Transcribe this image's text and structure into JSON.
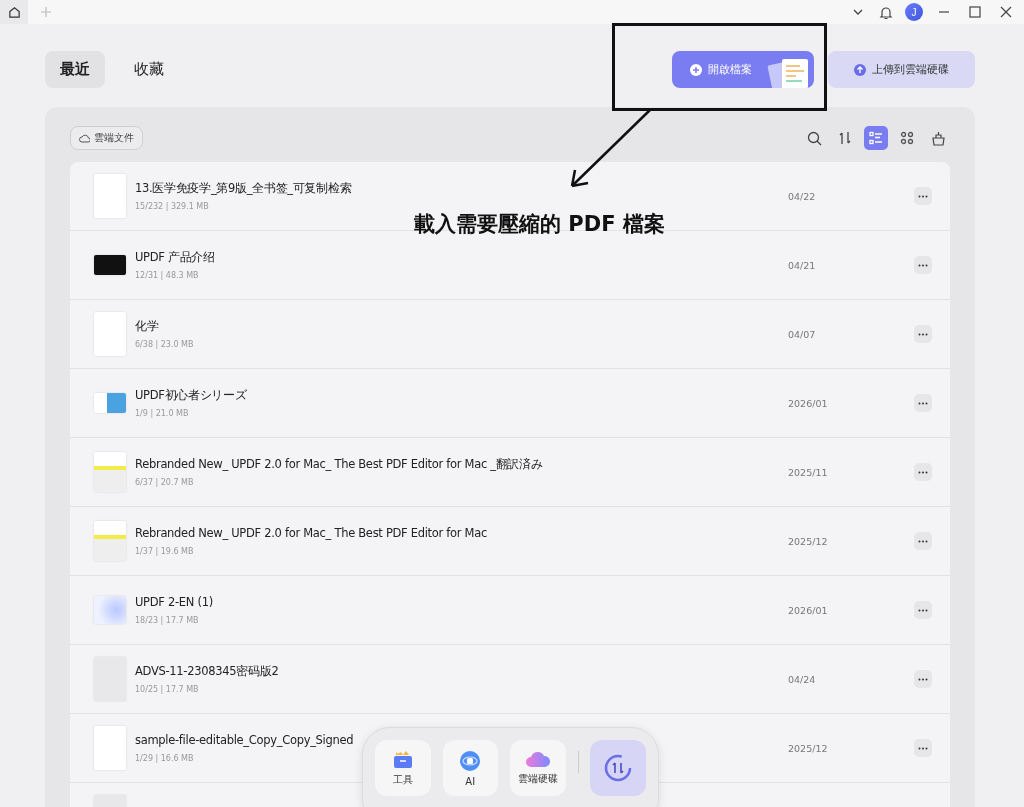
{
  "title_bar": {
    "avatar": "J"
  },
  "tabs": [
    {
      "label": "最近",
      "selected": true
    },
    {
      "label": "收藏",
      "selected": false
    }
  ],
  "actions": [
    {
      "kind": "open",
      "label": "開啟檔案"
    },
    {
      "kind": "upload",
      "label": "上傳到雲端硬碟"
    }
  ],
  "cloud_chip": "雲端文件",
  "view_modes": [
    {
      "kind": "list",
      "selected": true
    },
    {
      "kind": "grid",
      "selected": false
    }
  ],
  "files": [
    {
      "name": "13.医学免疫学_第9版_全书签_可复制检索",
      "meta": "15/232 | 329.1 MB",
      "date": "04/22",
      "kind": "doc"
    },
    {
      "name": "UPDF 产品介绍",
      "meta": "12/31 | 48.3 MB",
      "date": "04/21",
      "kind": "dark"
    },
    {
      "name": "化学",
      "meta": "6/38 | 23.0 MB",
      "date": "04/07",
      "kind": "doc"
    },
    {
      "name": "UPDF初心者シリーズ",
      "meta": "1/9 | 21.0 MB",
      "date": "2026/01",
      "kind": "screen"
    },
    {
      "name": "Rebranded New_ UPDF 2.0 for Mac_ The Best PDF Editor for Mac _翻訳済み",
      "meta": "6/37 | 20.7 MB",
      "date": "2025/11",
      "kind": "highlight"
    },
    {
      "name": "Rebranded New_ UPDF 2.0 for Mac_ The Best PDF Editor for Mac",
      "meta": "1/37 | 19.6 MB",
      "date": "2025/12",
      "kind": "highlight"
    },
    {
      "name": "UPDF 2-EN (1)",
      "meta": "18/23 | 17.7 MB",
      "date": "2026/01",
      "kind": "gradient"
    },
    {
      "name": "ADVS-11-2308345密码版2",
      "meta": "10/25 | 17.7 MB",
      "date": "04/24",
      "kind": "locked"
    },
    {
      "name": "sample-file-editable_Copy_Copy_Signed",
      "meta": "1/29 | 16.6 MB",
      "date": "2025/12",
      "kind": "doc"
    },
    {
      "kind": "locked"
    }
  ],
  "dock": [
    {
      "kind": "tools",
      "label": "工具"
    },
    {
      "kind": "ai",
      "label": "AI"
    },
    {
      "kind": "cloud",
      "label": "雲端硬碟"
    },
    {
      "kind": "convert"
    }
  ],
  "annotation": {
    "caption": "載入需要壓縮的 PDF 檔案"
  }
}
